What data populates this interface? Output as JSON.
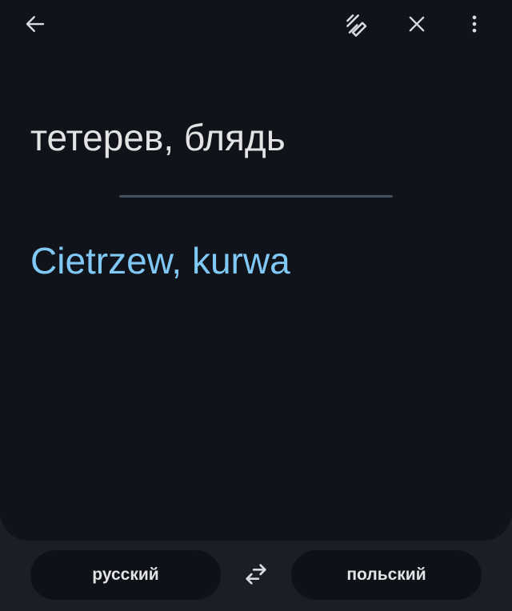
{
  "toolbar": {
    "back_icon": "arrow-left-icon",
    "handwriting_icon": "handwriting-pen-icon",
    "close_icon": "close-icon",
    "more_icon": "more-vert-icon"
  },
  "translation": {
    "source_text": "тетерев, блядь",
    "target_text": "Cietrzew, kurwa"
  },
  "languages": {
    "source_label": "русский",
    "target_label": "польский",
    "swap_icon": "swap-arrows-icon"
  },
  "colors": {
    "background": "#10141a",
    "source_text": "#e3e3e6",
    "target_text": "#80c8f5",
    "divider": "#45505e"
  }
}
